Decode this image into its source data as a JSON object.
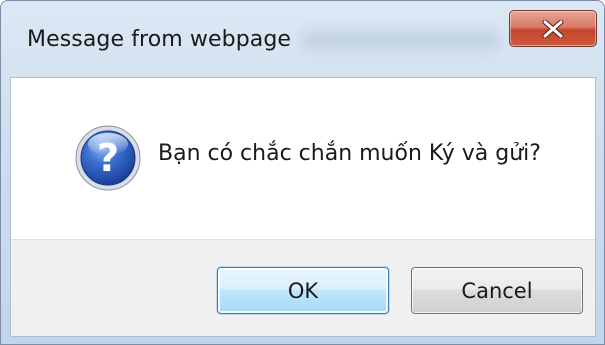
{
  "window": {
    "title": "Message from webpage",
    "close_icon": "close-x-icon"
  },
  "dialog": {
    "icon": "question-icon",
    "message": "Bạn có chắc chắn muốn Ký và gửi?"
  },
  "buttons": {
    "ok_label": "OK",
    "cancel_label": "Cancel"
  },
  "colors": {
    "frame": "#cfdeee",
    "close_button": "#c4452c",
    "default_button_border": "#3c7fb1",
    "button_area_bg": "#f0f0f0"
  }
}
